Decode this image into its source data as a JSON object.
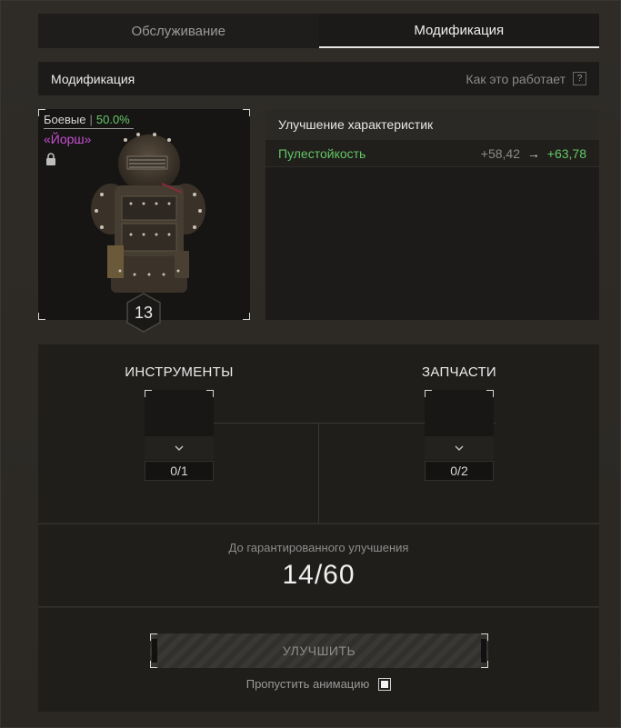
{
  "tabs": [
    {
      "label": "Обслуживание",
      "active": false
    },
    {
      "label": "Модификация",
      "active": true
    }
  ],
  "section": {
    "title": "Модификация",
    "how_it_works": "Как это работает",
    "help_glyph": "?"
  },
  "item": {
    "category": "Боевые",
    "separator": "|",
    "condition": "50.0%",
    "name": "«Йорш»",
    "level": "13",
    "locked": true,
    "name_color": "#c850d2"
  },
  "stats": {
    "title": "Улучшение характеристик",
    "rows": [
      {
        "name": "Пулестойкость",
        "from": "+58,42",
        "arrow": "→",
        "to": "+63,78"
      }
    ]
  },
  "materials": {
    "tools": {
      "title": "ИНСТРУМЕНТЫ",
      "count": "0/1"
    },
    "parts": {
      "title": "ЗАПЧАСТИ",
      "count": "0/2"
    }
  },
  "guarantee": {
    "label": "До гарантированного улучшения",
    "value": "14/60"
  },
  "upgrade": {
    "button_label": "УЛУЧШИТЬ",
    "skip_label": "Пропустить анимацию",
    "skip_checked": true
  },
  "colors": {
    "positive": "#62c665",
    "rarity": "#c850d2"
  }
}
